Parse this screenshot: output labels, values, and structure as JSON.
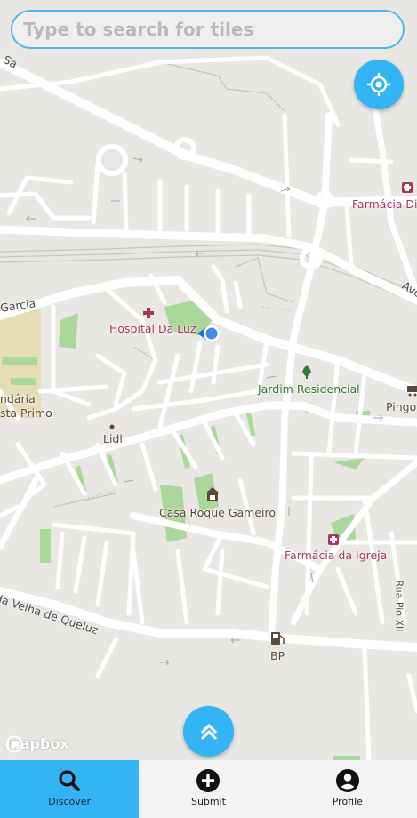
{
  "search": {
    "placeholder": "Type to search for tiles",
    "value": ""
  },
  "map": {
    "labels": {
      "sa": "Sá",
      "farmacia_dia": "Farmácia Dia",
      "ave": "Ave",
      "garcia": "Garcia",
      "hospital": "Hospital Da Luz",
      "jardim": "Jardim Residencial",
      "pingo": "Pingo",
      "lidl": "Lidl",
      "secundaria": "ndária",
      "primo": "sta Primo",
      "casa": "Casa Roque Gameiro",
      "farmacia_igreja": "Farmácia da Igreja",
      "rua_pio": "Rua Pio XII",
      "queluz": "da Velha de Queluz",
      "bp": "BP"
    },
    "attribution": "mapbox"
  },
  "nav": {
    "items": [
      {
        "label": "Discover",
        "icon": "search-icon",
        "active": true
      },
      {
        "label": "Submit",
        "icon": "plus-circle-icon",
        "active": false
      },
      {
        "label": "Profile",
        "icon": "account-circle-icon",
        "active": false
      }
    ]
  },
  "colors": {
    "accent": "#33b5f5",
    "road": "#ffffff",
    "land": "#e9e7e3",
    "park": "#a9d89a"
  }
}
